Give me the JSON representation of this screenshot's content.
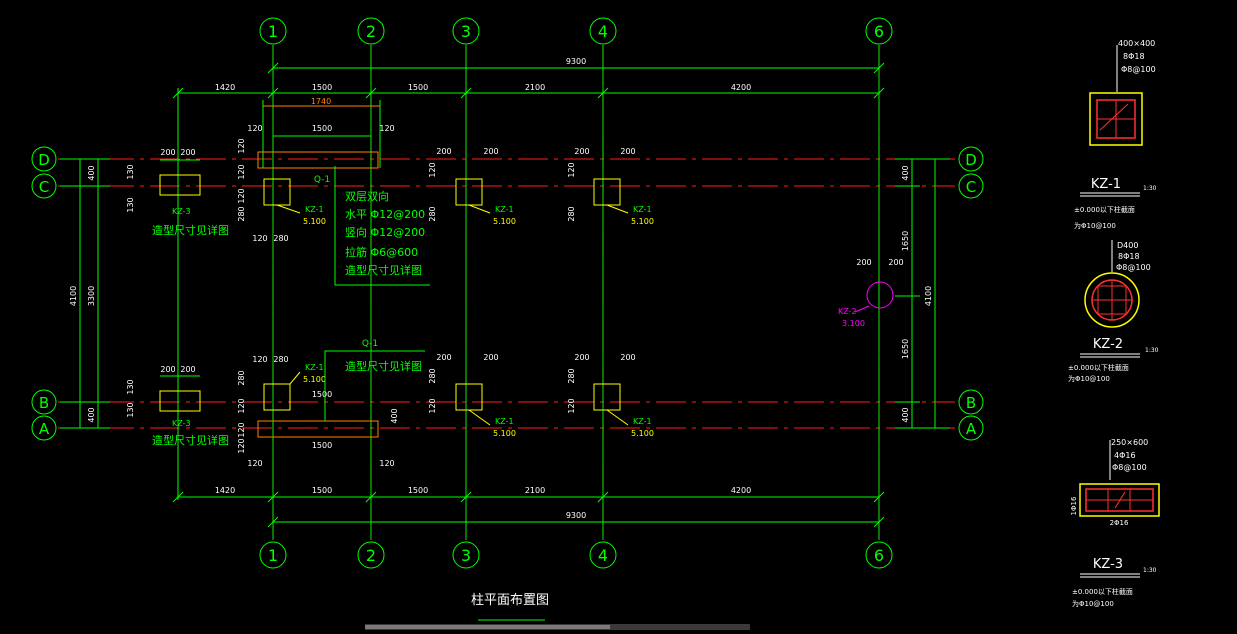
{
  "grid": {
    "cols": [
      "1",
      "2",
      "3",
      "4",
      "6"
    ],
    "rows": [
      "D",
      "C",
      "B",
      "A"
    ]
  },
  "dims": {
    "total": "9300",
    "top_segments": [
      "1420",
      "1500",
      "1500",
      "2100",
      "4200"
    ],
    "bottom_segments": [
      "1420",
      "1500",
      "1500",
      "2100",
      "4200"
    ],
    "left_outer": "4100",
    "left_inner": "3300",
    "left_400": "400",
    "right_total": "4100",
    "right_1650": "1650",
    "right_400": "400",
    "top_1740": "1740",
    "small_120": "120",
    "small_1500": "1500",
    "small_200": "200",
    "small_280": "280",
    "small_130": "130"
  },
  "labels": {
    "q1": "Q-1",
    "wall_note": [
      "双层双向",
      "水平 Φ12@200",
      "竖向 Φ12@200",
      "拉筋 Φ6@600",
      "造型尺寸见详图"
    ],
    "shape_note": "造型尺寸见详图",
    "kz1": "KZ-1",
    "kz2": "KZ-2",
    "kz3": "KZ-3",
    "elev_5100": "5.100",
    "elev_3100": "3.100",
    "plan_title": "柱平面布置图"
  },
  "details": {
    "kz1": {
      "size": "400×400",
      "main": "8Φ18",
      "stirrup": "Φ8@100",
      "name": "KZ-1",
      "scale": "1:30",
      "n1": "±0.000以下柱截面",
      "n2": "为Φ10@100"
    },
    "kz2": {
      "size": "D400",
      "main": "8Φ18",
      "stirrup": "Φ8@100",
      "name": "KZ-2",
      "scale": "1:30",
      "n1": "±0.000以下柱截面",
      "n2": "为Φ10@100"
    },
    "kz3": {
      "size": "250×600",
      "main": "4Φ16",
      "stirrup": "Φ8@100",
      "side": "1Φ16",
      "bottom": "2Φ16",
      "name": "KZ-3",
      "scale": "1:30",
      "n1": "±0.000以下柱截面",
      "n2": "为Φ10@100"
    }
  },
  "colors": {
    "background": "#000000",
    "dimension": "#00ff00",
    "axis": "#ff2020",
    "column": "#ffff00",
    "kz2": "#ff00ff",
    "text_white": "#ffffff",
    "rebar": "#ff3030",
    "wall": "#ff8000"
  }
}
